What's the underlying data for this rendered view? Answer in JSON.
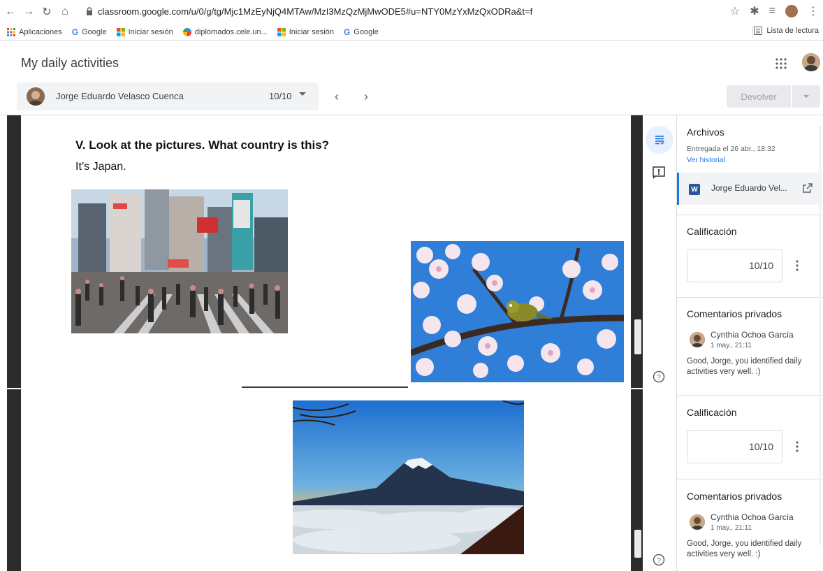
{
  "browser": {
    "url": "classroom.google.com/u/0/g/tg/Mjc1MzEyNjQ4MTAw/MzI3MzQzMjMwODE5#u=NTY0MzYxMzQxODRa&t=f",
    "bookmarks": [
      "Aplicaciones",
      "Google",
      "Iniciar sesión",
      "diplomados.cele.un...",
      "Iniciar sesión",
      "Google"
    ],
    "reading_list": "Lista de lectura"
  },
  "header": {
    "title": "My daily activities"
  },
  "student": {
    "name": "Jorge Eduardo Velasco Cuenca",
    "grade": "10/10"
  },
  "actions": {
    "return_label": "Devolver"
  },
  "document": {
    "question": "V. Look at the pictures. What country is this?",
    "answer": "It’s Japan."
  },
  "panel": {
    "files_title": "Archivos",
    "submitted": "Entregada el 26 abr., 18:32",
    "history_link": "Ver historial",
    "file_name": "Jorge Eduardo Vel...",
    "grade_title": "Calificación",
    "grade_value": "10/10",
    "comments_title": "Comentarios privados",
    "comment": {
      "author": "Cynthia Ochoa García",
      "date": "1 may., 21:11",
      "text": "Good, Jorge,  you identified daily activities very well. :)"
    }
  },
  "colors": {
    "accent": "#1a73e8",
    "word_blue": "#2b579a"
  }
}
